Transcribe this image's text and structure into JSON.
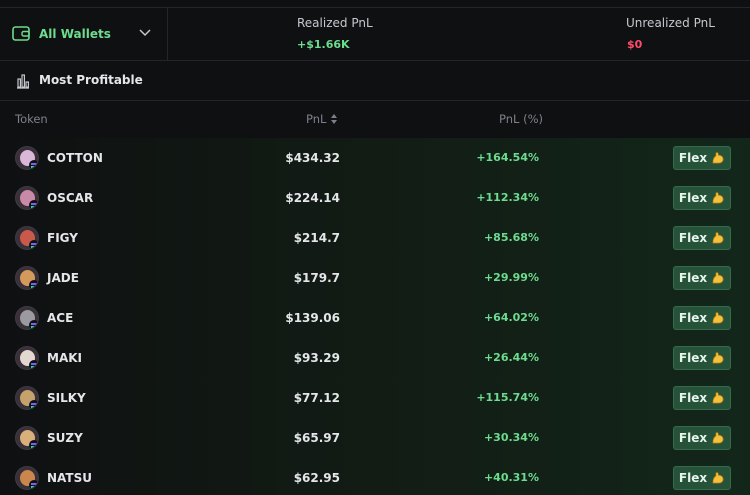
{
  "header": {
    "wallet_selector": {
      "label": "All Wallets",
      "icon": "wallet-icon"
    },
    "realized": {
      "label": "Realized PnL",
      "value": "+$1.66K",
      "color": "#6ddc8e"
    },
    "unrealized": {
      "label": "Unrealized PnL",
      "value": "$0",
      "color": "#ff4d6a"
    }
  },
  "section": {
    "title": "Most Profitable",
    "icon": "bar-chart-icon"
  },
  "table": {
    "columns": {
      "token": "Token",
      "pnl": "PnL",
      "pnl_pct": "PnL (%)"
    },
    "action_label": "Flex",
    "rows": [
      {
        "token": "COTTON",
        "pnl": "$434.32",
        "pnl_pct": "+164.54%",
        "avatar_color": "#d9b7d6"
      },
      {
        "token": "OSCAR",
        "pnl": "$224.14",
        "pnl_pct": "+112.34%",
        "avatar_color": "#c98aa8"
      },
      {
        "token": "FIGY",
        "pnl": "$214.7",
        "pnl_pct": "+85.68%",
        "avatar_color": "#c95a4a"
      },
      {
        "token": "JADE",
        "pnl": "$179.7",
        "pnl_pct": "+29.99%",
        "avatar_color": "#d39a5c"
      },
      {
        "token": "ACE",
        "pnl": "$139.06",
        "pnl_pct": "+64.02%",
        "avatar_color": "#9a9aa0"
      },
      {
        "token": "MAKI",
        "pnl": "$93.29",
        "pnl_pct": "+26.44%",
        "avatar_color": "#e3d8cf"
      },
      {
        "token": "SILKY",
        "pnl": "$77.12",
        "pnl_pct": "+115.74%",
        "avatar_color": "#c4a26b"
      },
      {
        "token": "SUZY",
        "pnl": "$65.97",
        "pnl_pct": "+30.34%",
        "avatar_color": "#d8b07a"
      },
      {
        "token": "NATSU",
        "pnl": "$62.95",
        "pnl_pct": "+40.31%",
        "avatar_color": "#c9874e"
      }
    ]
  }
}
